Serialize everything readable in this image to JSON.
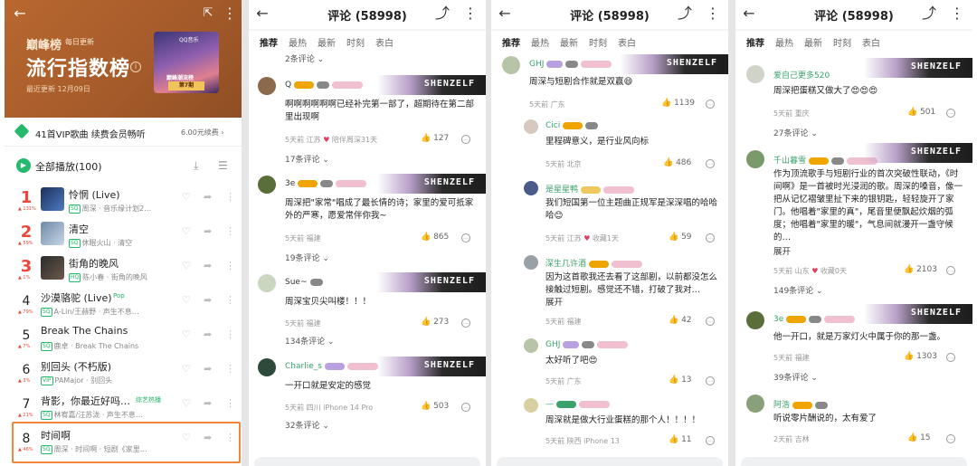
{
  "panel1": {
    "brand": "巅峰榜",
    "brand_sub": "每日更新",
    "title": "流行指数榜",
    "info": "i",
    "updated": "最近更新 12月09日",
    "cover": {
      "logo": "QQ音乐",
      "sub": "巅峰潮流榜",
      "label": "第7期"
    },
    "vip_text": "41首VIP歌曲 续费会员畅听",
    "vip_price": "6.00元续费 ›",
    "play_all": "全部播放(100)",
    "songs": [
      {
        "rank": "1",
        "title": "怜惘 (Live)",
        "artist": "周深 · 音乐缘计划2…",
        "trend": "▲ 131%"
      },
      {
        "rank": "2",
        "title": "清空",
        "artist": "休眠火山 · 清空",
        "trend": "▲ 59%"
      },
      {
        "rank": "3",
        "title": "街角的晚风",
        "artist": "陈小春 · 街角的晚风",
        "trend": "▲ 1%"
      },
      {
        "rank": "4",
        "title": "沙漠骆驼 (Live)",
        "artist": "A-Lin/王赫野 · 声生不息…",
        "trend": "▲ 79%",
        "pop": "Pop"
      },
      {
        "rank": "5",
        "title": "Break The Chains",
        "artist": "鹿卓 · Break The Chains",
        "trend": "▲ 7%"
      },
      {
        "rank": "6",
        "title": "别回头 (不朽版)",
        "artist": "PAMajor · 别回头",
        "trend": "▲ 3%"
      },
      {
        "rank": "7",
        "title": "背影，你最近好吗…",
        "artist": "林宥嘉/汪苏泷 · 声生不息…",
        "trend": "▲ 21%",
        "pop": "综艺热播"
      },
      {
        "rank": "8",
        "title": "时间啊",
        "artist": "周深 · 时间啊 · 短剧《家里…",
        "trend": "▲ 46%"
      }
    ]
  },
  "comments_title": "评论 (58998)",
  "tabs": [
    "推荐",
    "最热",
    "最新",
    "时刻",
    "表白"
  ],
  "banner": "SHENZELF",
  "panel2": {
    "top_reply": "2条评论 ⌄",
    "comments": [
      {
        "user": "Q",
        "text": "啊啊啊啊啊啊已经补完第一部了，超期待在第二部里出现啊",
        "meta": "5天前 江苏",
        "tag": "陪伴周深31天",
        "likes": "127",
        "replies": "17条评论 ⌄"
      },
      {
        "user": "3e",
        "text": "周深把\"家常\"唱成了最长情的诗；家里的爱可抵家外的严寒，愿爱常伴你我~",
        "meta": "5天前 福建",
        "likes": "865",
        "replies": "19条评论 ⌄"
      },
      {
        "user": "Sue~",
        "text": "周深宝贝尖叫楼！！！",
        "meta": "5天前 福建",
        "likes": "273",
        "replies": "134条评论 ⌄"
      },
      {
        "user": "Charlie_s",
        "text": "一开口就是安定的感觉",
        "meta": "5天前 四川   iPhone 14 Pro",
        "likes": "503",
        "replies": "32条评论 ⌄"
      }
    ]
  },
  "panel3": {
    "comments": [
      {
        "user": "GHJ",
        "text": "周深与短剧合作就是双赢😄",
        "meta": "5天前 广东",
        "likes": "1139"
      },
      {
        "user": "Cici",
        "text": "里程碑意义，是行业风向标",
        "meta": "5天前 北京",
        "likes": "486"
      },
      {
        "user": "是星星鸭",
        "text": "我们短国第一位主题曲正规军是深深唱的哈哈哈😊",
        "meta": "5天前 江苏",
        "tag": "收藏1天",
        "likes": "59"
      },
      {
        "user": "深生几许酒",
        "text": "因为这首歌我还去看了这部剧，以前都没怎么接触过短剧。感觉还不错，打破了我对…",
        "expand": "展开",
        "meta": "5天前 福建",
        "likes": "42"
      },
      {
        "user": "GHJ",
        "text": "太好听了吧😍",
        "meta": "5天前 广东",
        "likes": "13"
      },
      {
        "user": "—",
        "text": "周深就是做大行业蛋糕的那个人！！！！",
        "meta": "5天前 陕西   iPhone 13",
        "likes": "11"
      }
    ]
  },
  "panel4": {
    "comments": [
      {
        "user": "爱自己更多520",
        "text": "周深把蛋糕又做大了😍😍😍",
        "meta": "5天前 重庆",
        "likes": "501",
        "replies": "27条评论 ⌄"
      },
      {
        "user": "千山暮雪",
        "text": "作为顶流歌手与短剧行业的首次突破性联动，《时间啊》是一首被时光浸润的歌。周深的嗓音，像一把从记忆褶皱里扯下来的银钥匙，轻轻旋开了家门。他唱着\"家里的真\"，尾音里便飘起炊烟的弧度；他唱着\"家里的暖\"，气息间就漫开一盏守候的…",
        "expand": "展开",
        "meta": "5天前 山东",
        "tag": "收藏0天",
        "likes": "2103",
        "replies": "149条评论 ⌄"
      },
      {
        "user": "3e",
        "text": "他一开口，就是万家灯火中属于你的那一盏。",
        "meta": "5天前 福建",
        "likes": "1303",
        "replies": "39条评论 ⌄"
      },
      {
        "user": "阿浩",
        "text": "听说零片酬说的，太有爱了",
        "meta": "2天前 吉林",
        "likes": "15"
      }
    ]
  }
}
